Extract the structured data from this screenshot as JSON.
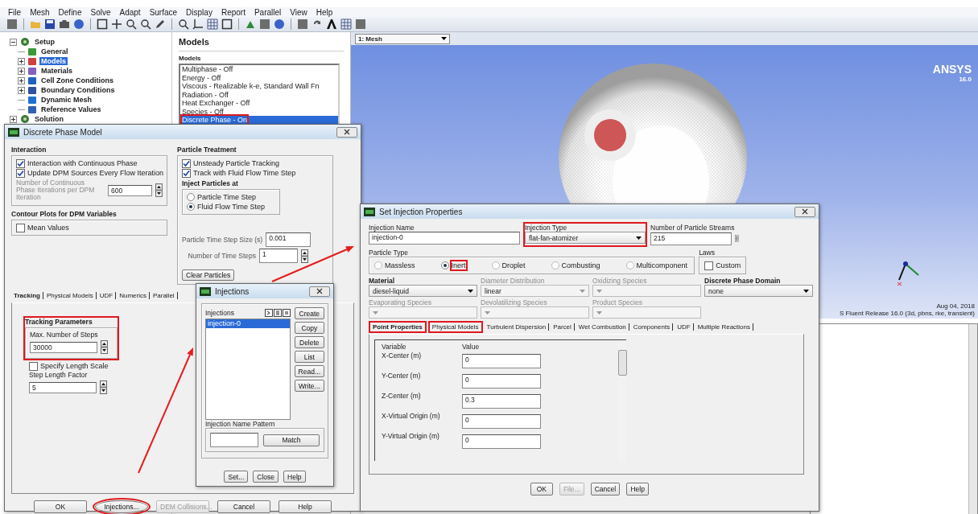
{
  "menu_bar": [
    "File",
    "Mesh",
    "Define",
    "Solve",
    "Adapt",
    "Surface",
    "Display",
    "Report",
    "Parallel",
    "View",
    "Help"
  ],
  "tree": [
    {
      "label": "Setup",
      "kind": "group",
      "expanded": true,
      "selected": false,
      "children": [
        {
          "label": "General",
          "kind": "leaf",
          "selected": false
        },
        {
          "label": "Models",
          "kind": "group",
          "expanded": false,
          "selected": true
        },
        {
          "label": "Materials",
          "kind": "group",
          "expanded": false,
          "selected": false
        },
        {
          "label": "Cell Zone Conditions",
          "kind": "group",
          "expanded": false,
          "selected": false
        },
        {
          "label": "Boundary Conditions",
          "kind": "group",
          "expanded": false,
          "selected": false
        },
        {
          "label": "Dynamic Mesh",
          "kind": "leaf",
          "selected": false
        },
        {
          "label": "Reference Values",
          "kind": "leaf",
          "selected": false
        }
      ]
    },
    {
      "label": "Solution",
      "kind": "group",
      "expanded": false,
      "selected": false
    }
  ],
  "models_panel": {
    "title": "Models",
    "list_label": "Models",
    "items": [
      {
        "label": "Multiphase - Off",
        "selected": false,
        "highlighted": false
      },
      {
        "label": "Energy - Off",
        "selected": false,
        "highlighted": false
      },
      {
        "label": "Viscous - Realizable k-e, Standard Wall Fn",
        "selected": false,
        "highlighted": false
      },
      {
        "label": "Radiation - Off",
        "selected": false,
        "highlighted": false
      },
      {
        "label": "Heat Exchanger - Off",
        "selected": false,
        "highlighted": false
      },
      {
        "label": "Species - Off",
        "selected": false,
        "highlighted": false
      },
      {
        "label": "Discrete Phase - On",
        "selected": true,
        "highlighted": true
      }
    ]
  },
  "graphics": {
    "view": "1: Mesh",
    "logo": "ANSYS",
    "version": "16.0",
    "date": "Aug 04, 2018",
    "release": "S Fluent Release 16.0 (3d, pbns, rke, transient)"
  },
  "dpm_dialog": {
    "title": "Discrete Phase Model",
    "interaction": {
      "title": "Interaction",
      "options": [
        {
          "label": "Interaction with Continuous Phase",
          "checked": true
        },
        {
          "label": "Update DPM Sources Every Flow Iteration",
          "checked": true
        }
      ],
      "iterations_label": "Number of Continuous Phase Iterations per DPM Iteration",
      "iterations_value": "600",
      "iterations_disabled": true
    },
    "contour": {
      "title": "Contour Plots for DPM Variables",
      "options": [
        {
          "label": "Mean Values",
          "checked": false
        }
      ]
    },
    "particle_treatment": {
      "title": "Particle Treatment",
      "options": [
        {
          "label": "Unsteady Particle Tracking",
          "checked": true
        },
        {
          "label": "Track with Fluid Flow Time Step",
          "checked": true
        }
      ],
      "inject_title": "Inject Particles at",
      "inject_options": [
        {
          "label": "Particle Time Step",
          "selected": false
        },
        {
          "label": "Fluid Flow Time Step",
          "selected": true
        }
      ],
      "time_step_label": "Particle Time Step Size (s)",
      "time_step_value": "0.001",
      "steps_label": "Number of Time Steps",
      "steps_value": "1",
      "clear_button": "Clear Particles"
    },
    "tabs": [
      {
        "label": "Tracking",
        "selected": true
      },
      {
        "label": "Physical Models",
        "selected": false
      },
      {
        "label": "UDF",
        "selected": false
      },
      {
        "label": "Numerics",
        "selected": false
      },
      {
        "label": "Parallel",
        "selected": false
      }
    ],
    "tracking": {
      "title": "Tracking Parameters",
      "highlighted": true,
      "max_steps_label": "Max. Number of Steps",
      "max_steps_value": "30000",
      "length_scale": {
        "label": "Specify Length Scale",
        "checked": false
      },
      "factor_label": "Step Length Factor",
      "factor_value": "5"
    },
    "buttons": [
      {
        "label": "OK",
        "disabled": false,
        "highlighted": false
      },
      {
        "label": "Injections...",
        "disabled": false,
        "highlighted": true
      },
      {
        "label": "DEM Collisions...",
        "disabled": true,
        "highlighted": false
      },
      {
        "label": "Cancel",
        "disabled": false,
        "highlighted": false
      },
      {
        "label": "Help",
        "disabled": false,
        "highlighted": false
      }
    ]
  },
  "injections_dialog": {
    "title": "Injections",
    "list_label": "Injections",
    "items": [
      {
        "label": "injection-0",
        "selected": true
      }
    ],
    "side_buttons": [
      "Create",
      "Copy",
      "Delete",
      "List",
      "Read...",
      "Write..."
    ],
    "pattern_label": "Injection Name Pattern",
    "match_button": "Match",
    "buttons": [
      "Set...",
      "Close",
      "Help"
    ]
  },
  "set_injection_dialog": {
    "title": "Set Injection Properties",
    "name_label": "Injection Name",
    "name_value": "injection-0",
    "type_label": "Injection Type",
    "type_value": "flat-fan-atomizer",
    "type_highlighted": true,
    "streams_label": "Number of Particle Streams",
    "streams_value": "215",
    "particle_type_label": "Particle Type",
    "particle_types": [
      {
        "label": "Massless",
        "selected": false,
        "highlighted": false
      },
      {
        "label": "Inert",
        "selected": true,
        "highlighted": true
      },
      {
        "label": "Droplet",
        "selected": false,
        "highlighted": false
      },
      {
        "label": "Combusting",
        "selected": false,
        "highlighted": false
      },
      {
        "label": "Multicomponent",
        "selected": false,
        "highlighted": false
      }
    ],
    "laws_label": "Laws",
    "custom": {
      "label": "Custom",
      "checked": false
    },
    "dropdowns": [
      {
        "label": "Material",
        "value": "diesel-liquid",
        "disabled": false
      },
      {
        "label": "Diameter Distribution",
        "value": "linear",
        "disabled": true
      },
      {
        "label": "Oxidizing Species",
        "disabled": true
      },
      {
        "label": "Discrete Phase Domain",
        "value": "none",
        "disabled": false
      },
      {
        "label": "Evaporating Species",
        "disabled": true
      },
      {
        "label": "Devolatilizing Species",
        "disabled": true
      },
      {
        "label": "Product Species",
        "disabled": true
      }
    ],
    "tabs": [
      {
        "label": "Point Properties",
        "selected": true,
        "highlighted": true
      },
      {
        "label": "Physical Models",
        "selected": false,
        "highlighted": true
      },
      {
        "label": "Turbulent Dispersion",
        "selected": false,
        "highlighted": false
      },
      {
        "label": "Parcel",
        "selected": false,
        "highlighted": false
      },
      {
        "label": "Wet Combustion",
        "selected": false,
        "highlighted": false
      },
      {
        "label": "Components",
        "selected": false,
        "highlighted": false
      },
      {
        "label": "UDF",
        "selected": false,
        "highlighted": false
      },
      {
        "label": "Multiple Reactions",
        "selected": false,
        "highlighted": false
      }
    ],
    "table": {
      "columns": [
        "Variable",
        "Value"
      ],
      "rows": [
        {
          "variable": "X-Center (m)",
          "value": "0"
        },
        {
          "variable": "Y-Center (m)",
          "value": "0"
        },
        {
          "variable": "Z-Center (m)",
          "value": "0.3"
        },
        {
          "variable": "X-Virtual Origin (m)",
          "value": "0"
        },
        {
          "variable": "Y-Virtual Origin (m)",
          "value": "0"
        }
      ]
    },
    "buttons": [
      {
        "label": "OK",
        "disabled": false
      },
      {
        "label": "File...",
        "disabled": true
      },
      {
        "label": "Cancel",
        "disabled": false
      },
      {
        "label": "Help",
        "disabled": false
      }
    ]
  }
}
